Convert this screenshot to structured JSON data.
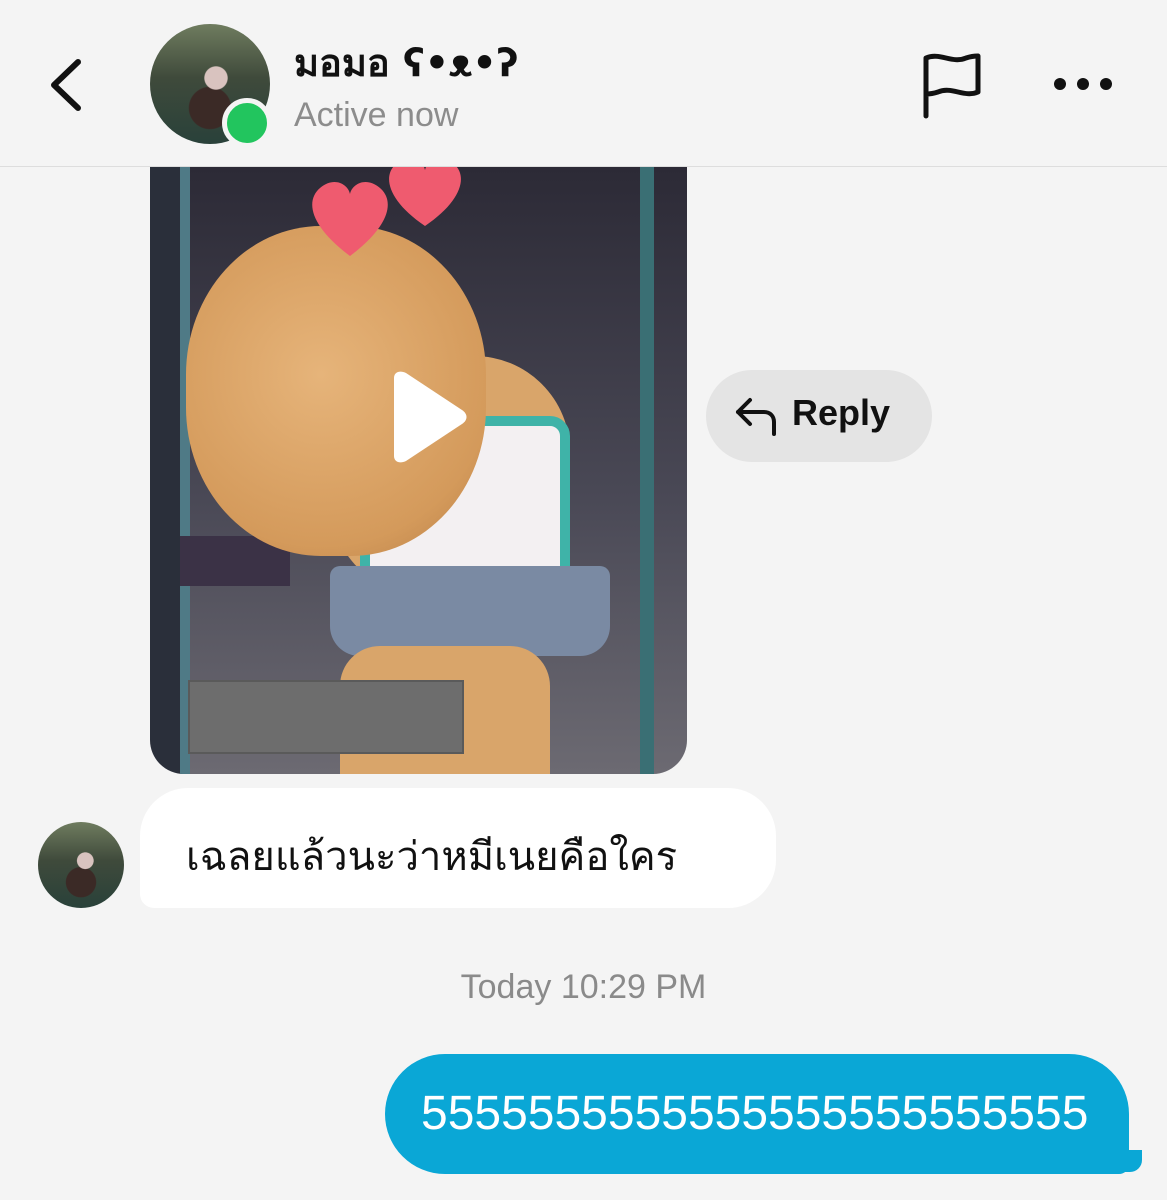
{
  "header": {
    "contact_name": "มอมอ ʕ•ᴥ•ʔ",
    "status": "Active now"
  },
  "media": {
    "type": "video"
  },
  "actions": {
    "reply_label": "Reply"
  },
  "messages": {
    "incoming": [
      {
        "text": "เฉลยแล้วนะว่าหมีเนยคือใคร"
      }
    ],
    "timestamp": "Today 10:29 PM",
    "outgoing": [
      {
        "text": "5555555555555555555555555"
      }
    ]
  },
  "colors": {
    "online": "#22c55e",
    "outgoing_bubble": "#0aa7d6",
    "background": "#f4f4f4"
  },
  "icons": [
    "chevron-left-icon",
    "flag-icon",
    "more-horizontal-icon",
    "play-icon",
    "reply-arrow-icon"
  ]
}
